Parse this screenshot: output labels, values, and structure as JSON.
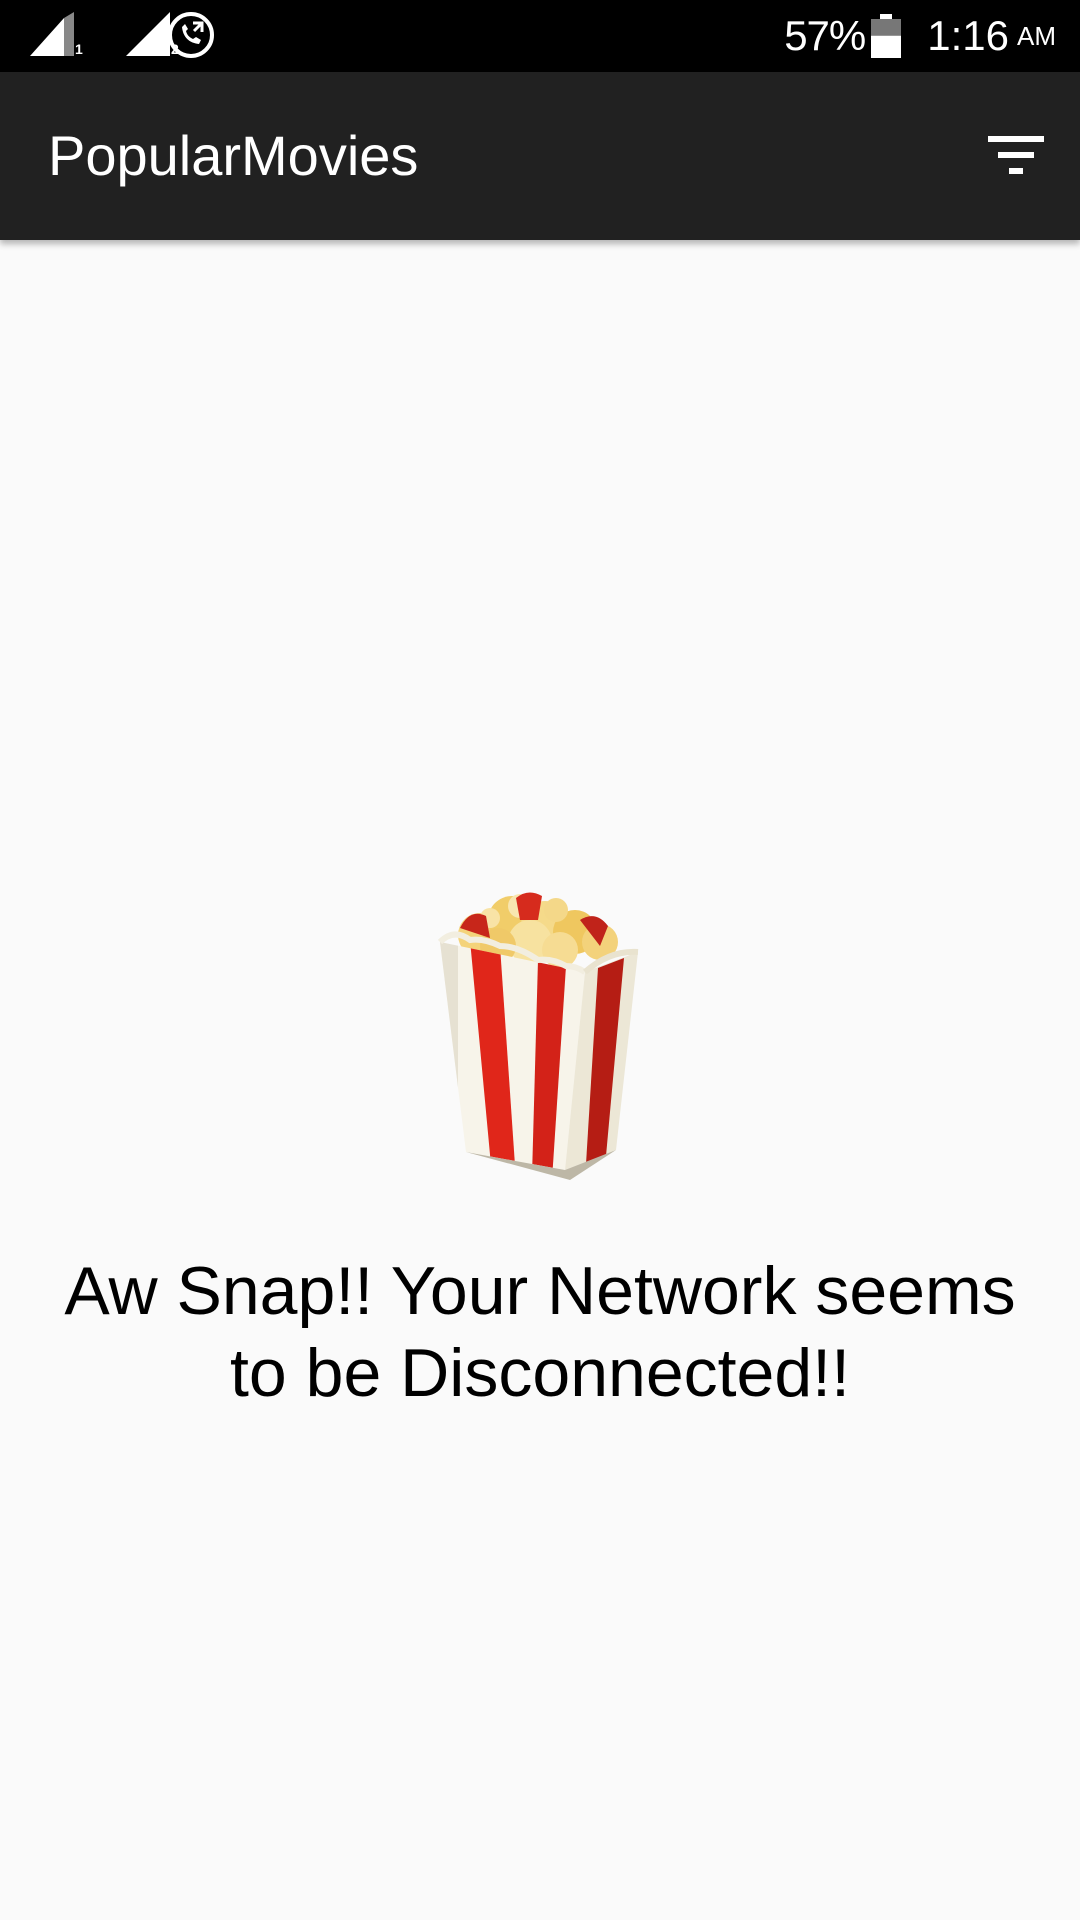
{
  "status_bar": {
    "sim1_label": "1",
    "sim2_label": "2",
    "icons": [
      "signal-icon",
      "signal-icon",
      "call-icon",
      "battery-icon"
    ],
    "battery_percent": "57%",
    "battery_level": 0.57,
    "time": "1:16",
    "ampm": "AM"
  },
  "app_bar": {
    "title": "PopularMovies",
    "filter_icon": "filter-icon",
    "background_color": "#212121"
  },
  "empty_state": {
    "image": "popcorn-icon",
    "message": "Aw Snap!! Your Network seems to be Disconnected!!"
  },
  "colors": {
    "status_bar": "#000000",
    "background": "#fafafa",
    "popcorn_red": "#e0261a",
    "popcorn_white": "#f7f4ea"
  }
}
